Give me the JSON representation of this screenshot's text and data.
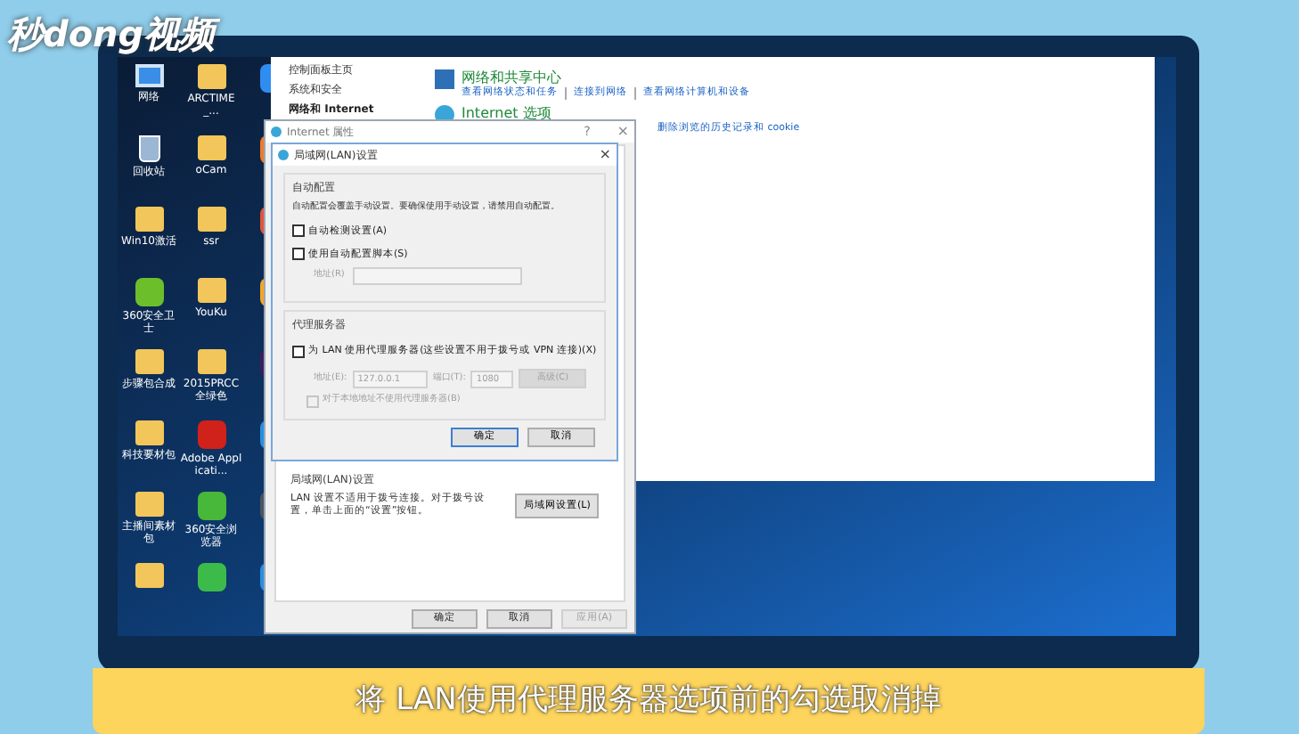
{
  "logo": "秒dong视频",
  "desktop_icons": [
    {
      "label": "网络",
      "kind": "network"
    },
    {
      "label": "ARCTIME_...",
      "kind": "folder"
    },
    {
      "kind": "app",
      "color": "#2f8df2"
    },
    {
      "label": "回收站",
      "kind": "bin"
    },
    {
      "label": "oCam",
      "kind": "folder"
    },
    {
      "kind": "app",
      "color": "#f07a2a"
    },
    {
      "label": "Win10激活",
      "kind": "folder"
    },
    {
      "label": "ssr",
      "kind": "folder"
    },
    {
      "kind": "app",
      "color": "#e2553a"
    },
    {
      "label": "360安全卫士",
      "kind": "app",
      "color": "#6cbf2a"
    },
    {
      "label": "YouKu",
      "kind": "folder"
    },
    {
      "kind": "app",
      "color": "#f5a623"
    },
    {
      "label": "步骤包合成",
      "kind": "folder"
    },
    {
      "label": "2015PRCC全绿色",
      "kind": "folder"
    },
    {
      "kind": "app",
      "color": "#3b1f5e"
    },
    {
      "label": "科技要材包",
      "kind": "folder"
    },
    {
      "label": "Adobe Applicati...",
      "kind": "app",
      "color": "#d0211b"
    },
    {
      "kind": "app",
      "color": "#2a8fe0"
    },
    {
      "label": "主播间素材包",
      "kind": "folder"
    },
    {
      "label": "360安全浏览器",
      "kind": "app",
      "color": "#47b83a"
    },
    {
      "kind": "app",
      "color": "#4b5560"
    },
    {
      "kind": "folder"
    },
    {
      "kind": "app",
      "color": "#3dbb4a"
    },
    {
      "kind": "app",
      "color": "#2a8fe0"
    }
  ],
  "control_panel": {
    "nav": [
      "控制面板主页",
      "系统和安全",
      "网络和 Internet"
    ],
    "sections": [
      {
        "title": "网络和共享中心",
        "links": [
          "查看网络状态和任务",
          "连接到网络",
          "查看网络计算机和设备"
        ]
      },
      {
        "title": "Internet 选项",
        "links": [
          "删除浏览的历史记录和 cookie"
        ]
      }
    ]
  },
  "internet_properties": {
    "title": "Internet 属性",
    "help": "?",
    "close": "×",
    "lan_heading": "局域网(LAN)设置",
    "lan_text": "LAN 设置不适用于拨号连接。对于拨号设置，单击上面的“设置”按钮。",
    "lan_button": "局域网设置(L)",
    "buttons": [
      {
        "label": "确定",
        "disabled": false
      },
      {
        "label": "取消",
        "disabled": false
      },
      {
        "label": "应用(A)",
        "disabled": true
      }
    ]
  },
  "lan_dialog": {
    "title": "局域网(LAN)设置",
    "close": "×",
    "auto_group": {
      "title": "自动配置",
      "text": "自动配置会覆盖手动设置。要确保使用手动设置，请禁用自动配置。",
      "options": [
        {
          "label": "自动检测设置(A)",
          "checked": false
        },
        {
          "label": "使用自动配置脚本(S)",
          "checked": false
        }
      ],
      "address_label": "地址(R)"
    },
    "proxy_group": {
      "title": "代理服务器",
      "option": {
        "label": "为 LAN 使用代理服务器(这些设置不用于拨号或 VPN 连接)(X)",
        "checked": false
      },
      "address_label": "地址(E):",
      "address": "127.0.0.1",
      "port_label": "端口(T):",
      "port": "1080",
      "advanced": "高级(C)",
      "bypass": {
        "label": "对于本地地址不使用代理服务器(B)",
        "checked": false,
        "disabled": true
      }
    },
    "buttons": [
      "确定",
      "取消"
    ]
  },
  "caption": "将 LAN使用代理服务器选项前的勾选取消掉"
}
